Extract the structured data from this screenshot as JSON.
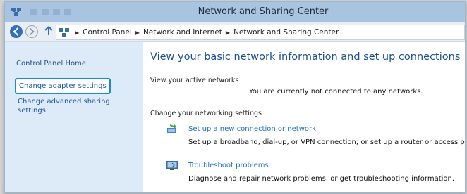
{
  "window": {
    "title": "Network and Sharing Center"
  },
  "address_bar": {
    "crumbs": [
      "Control Panel",
      "Network and Internet",
      "Network and Sharing Center"
    ]
  },
  "sidebar": {
    "items": [
      {
        "label": "Control Panel Home"
      },
      {
        "label": "Change adapter settings",
        "highlighted": true
      },
      {
        "label": "Change advanced sharing settings"
      }
    ]
  },
  "main": {
    "heading": "View your basic network information and set up connections",
    "active_networks_label": "View your active networks",
    "no_network_message": "You are currently not connected to any networks.",
    "change_settings_label": "Change your networking settings",
    "tasks": [
      {
        "icon": "new-connection-icon",
        "link": "Set up a new connection or network",
        "description": "Set up a broadband, dial-up, or VPN connection; or set up a router or access point."
      },
      {
        "icon": "troubleshoot-icon",
        "link": "Troubleshoot problems",
        "description": "Diagnose and repair network problems, or get troubleshooting information."
      }
    ]
  },
  "colors": {
    "titlebar": "#a9c4e1",
    "sidebar": "#ddeaf8",
    "heading": "#1b4f91",
    "link": "#1f6fbf",
    "highlight_border": "#1a8ad8"
  }
}
